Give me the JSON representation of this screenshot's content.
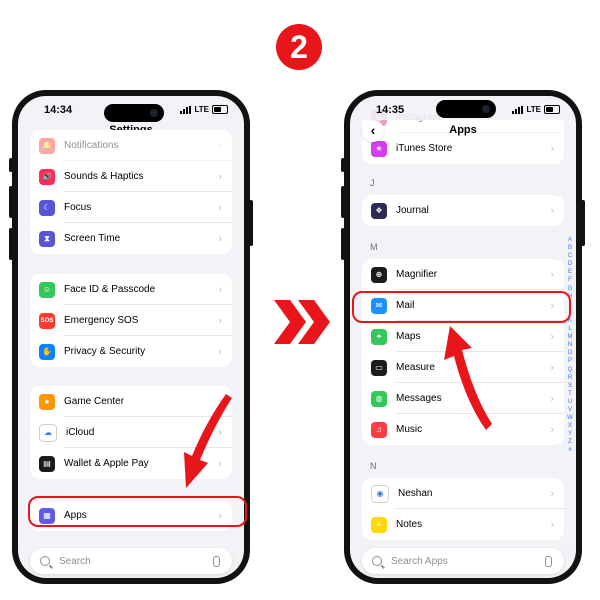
{
  "step_number": "2",
  "left_screen": {
    "time": "14:34",
    "network": "LTE",
    "title": "Settings",
    "group1": [
      {
        "label": "Notifications",
        "icon": "bell-icon",
        "color": "#ff3b30"
      },
      {
        "label": "Sounds & Haptics",
        "icon": "speaker-icon",
        "color": "#ff2d55"
      },
      {
        "label": "Focus",
        "icon": "moon-icon",
        "color": "#5856d6"
      },
      {
        "label": "Screen Time",
        "icon": "hourglass-icon",
        "color": "#5856d6"
      }
    ],
    "group2": [
      {
        "label": "Face ID & Passcode",
        "icon": "face-id-icon",
        "color": "#34c759"
      },
      {
        "label": "Emergency SOS",
        "icon": "sos-icon",
        "color": "#ff3b30",
        "glyph": "SOS"
      },
      {
        "label": "Privacy & Security",
        "icon": "hand-icon",
        "color": "#0a84ff"
      }
    ],
    "group3": [
      {
        "label": "Game Center",
        "icon": "game-center-icon",
        "color": "#ff9500"
      },
      {
        "label": "iCloud",
        "icon": "cloud-icon",
        "color": "#ffffff"
      },
      {
        "label": "Wallet & Apple Pay",
        "icon": "wallet-icon",
        "color": "#1c1c1e"
      }
    ],
    "group4": [
      {
        "label": "Apps",
        "icon": "apps-grid-icon",
        "color": "#5e5ce6"
      }
    ],
    "search_placeholder": "Search"
  },
  "right_screen": {
    "time": "14:35",
    "network": "LTE",
    "title": "Apps",
    "top_group": [
      {
        "label": "Instagram",
        "icon": "instagram-icon",
        "color": "#c13584"
      },
      {
        "label": "iTunes Store",
        "icon": "itunes-store-icon",
        "color": "#d63cf0"
      }
    ],
    "section_j": "J",
    "j_items": [
      {
        "label": "Journal",
        "icon": "journal-icon",
        "color": "#2c2c54"
      }
    ],
    "section_m": "M",
    "m_items": [
      {
        "label": "Magnifier",
        "icon": "magnifier-icon",
        "color": "#1c1c1e"
      },
      {
        "label": "Mail",
        "icon": "mail-icon",
        "color": "#1e90ff"
      },
      {
        "label": "Maps",
        "icon": "maps-icon",
        "color": "#34c759"
      },
      {
        "label": "Measure",
        "icon": "measure-icon",
        "color": "#1c1c1e"
      },
      {
        "label": "Messages",
        "icon": "messages-icon",
        "color": "#34c759"
      },
      {
        "label": "Music",
        "icon": "music-icon",
        "color": "#fc3c44"
      }
    ],
    "section_n": "N",
    "n_items": [
      {
        "label": "Neshan",
        "icon": "neshan-icon",
        "color": "#ffffff"
      },
      {
        "label": "Notes",
        "icon": "notes-icon",
        "color": "#ffd60a"
      }
    ],
    "index_letters": "A B C D E F G H I J K L M N O P Q R S T U V W X Y Z #",
    "search_placeholder": "Search Apps"
  },
  "colors": {
    "accent_red": "#e8161b",
    "link_blue": "#3478f6"
  }
}
